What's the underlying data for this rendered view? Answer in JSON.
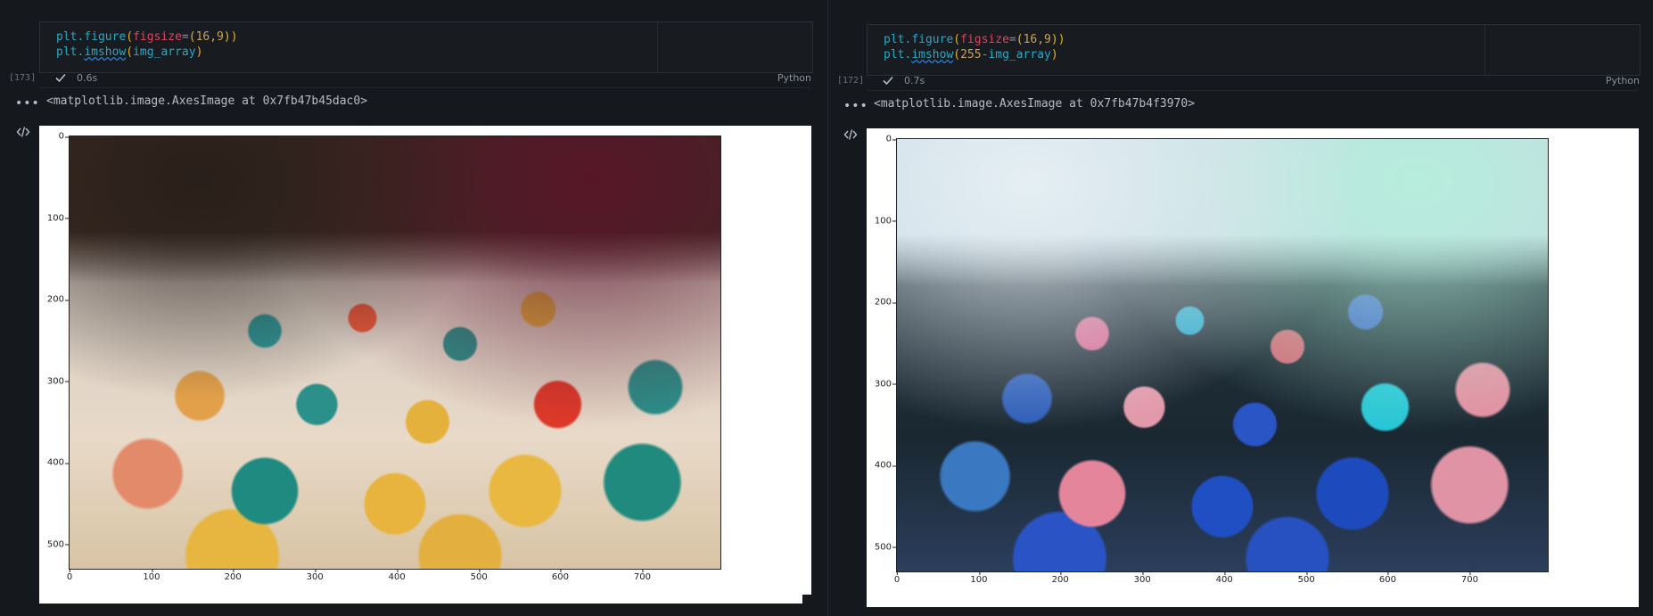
{
  "cells": [
    {
      "exec_count": "[173]",
      "code": {
        "line1": {
          "fn": "plt",
          "dot": ".",
          "method": "figure",
          "open": "(",
          "kw": "figsize",
          "eq": "=",
          "tuple_open": "(",
          "nums": "16,9",
          "tuple_close": ")",
          "close": ")"
        },
        "line2": {
          "fn": "plt",
          "dot": ".",
          "method": "imshow",
          "open": "(",
          "arg": "img_array",
          "close": ")"
        }
      },
      "exec_time": "0.6s",
      "language": "Python",
      "output_text": "<matplotlib.image.AxesImage at 0x7fb47b45dac0>",
      "plot": {
        "yticks": [
          "0",
          "100",
          "200",
          "300",
          "400",
          "500"
        ],
        "xticks": [
          "0",
          "100",
          "200",
          "300",
          "400",
          "500",
          "600",
          "700"
        ]
      }
    },
    {
      "exec_count": "[172]",
      "code": {
        "line1": {
          "fn": "plt",
          "dot": ".",
          "method": "figure",
          "open": "(",
          "kw": "figsize",
          "eq": "=",
          "tuple_open": "(",
          "nums": "16,9",
          "tuple_close": ")",
          "close": ")"
        },
        "line2": {
          "fn": "plt",
          "dot": ".",
          "method": "imshow",
          "open": "(",
          "num": "255",
          "op": "-",
          "arg": "img_array",
          "close": ")"
        }
      },
      "exec_time": "0.7s",
      "language": "Python",
      "output_text": "<matplotlib.image.AxesImage at 0x7fb47b4f3970>",
      "plot": {
        "yticks": [
          "0",
          "100",
          "200",
          "300",
          "400",
          "500"
        ],
        "xticks": [
          "0",
          "100",
          "200",
          "300",
          "400",
          "500",
          "600",
          "700"
        ]
      }
    }
  ],
  "icons": {
    "check": "check-icon",
    "more": "more-horizontal-icon",
    "code": "code-icon"
  }
}
